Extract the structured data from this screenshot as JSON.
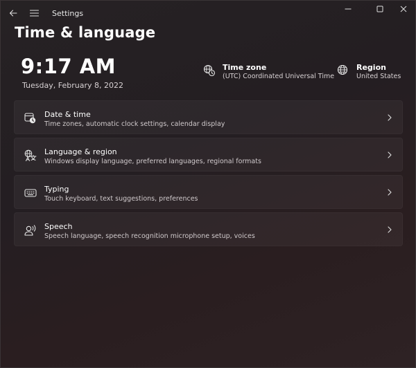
{
  "titlebar": {
    "app_title": "Settings",
    "back_icon": "back-arrow-icon",
    "menu_icon": "hamburger-menu-icon",
    "window_controls": [
      "minimize-icon",
      "maximize-icon",
      "close-icon"
    ]
  },
  "page": {
    "title": "Time & language"
  },
  "header": {
    "time": "9:17 AM",
    "date": "Tuesday, February 8, 2022",
    "timezone": {
      "label": "Time zone",
      "value": "(UTC) Coordinated Universal Time",
      "icon": "globe-clock-icon"
    },
    "region": {
      "label": "Region",
      "value": "United States",
      "icon": "globe-icon"
    }
  },
  "cards": [
    {
      "title": "Date & time",
      "subtitle": "Time zones, automatic clock settings, calendar display",
      "icon": "calendar-clock-icon"
    },
    {
      "title": "Language & region",
      "subtitle": "Windows display language, preferred languages, regional formats",
      "icon": "language-icon"
    },
    {
      "title": "Typing",
      "subtitle": "Touch keyboard, text suggestions, preferences",
      "icon": "keyboard-icon"
    },
    {
      "title": "Speech",
      "subtitle": "Speech language, speech recognition microphone setup, voices",
      "icon": "speech-icon"
    }
  ],
  "colors": {
    "text": "#ffffff",
    "secondary_text": "#d0cacc",
    "card_bg": "#2f2a2c"
  }
}
